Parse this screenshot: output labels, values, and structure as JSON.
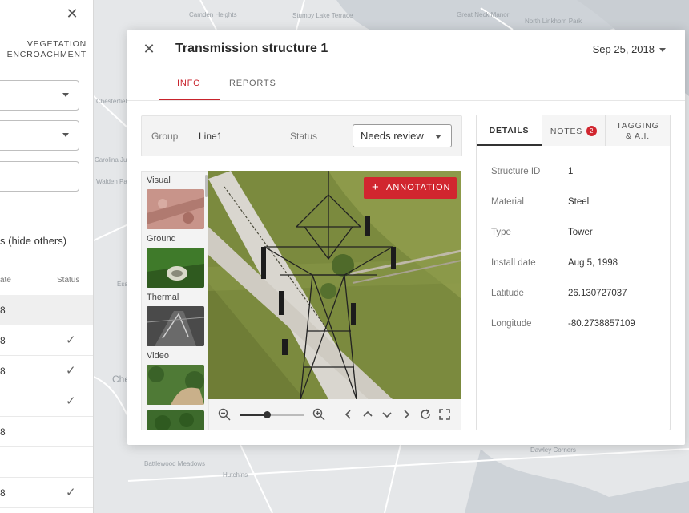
{
  "map": {
    "labels": [
      "Camden Heights",
      "Stumpy Lake Terrace",
      "Great Neck Manor",
      "North Linkhorn Park",
      "Chesterfield",
      "Carolina Junction",
      "Walden Park",
      "Essex",
      "Che",
      "Battlewood Meadows",
      "Hutchins",
      "Dawley Corners"
    ]
  },
  "left_panel": {
    "header_line1": "VEGETATION",
    "header_line2": "ENCROACHMENT",
    "toggle_label": "s (hide others)",
    "col_date": "ate",
    "col_status": "Status",
    "rows": [
      {
        "date": "8",
        "checked": false,
        "selected": true
      },
      {
        "date": "8",
        "checked": true
      },
      {
        "date": "8",
        "checked": true
      },
      {
        "date": "",
        "checked": true
      },
      {
        "date": "8",
        "checked": false
      },
      {
        "date": "",
        "checked": false
      },
      {
        "date": "8",
        "checked": true
      }
    ],
    "check_glyph": "✓"
  },
  "modal": {
    "title": "Transmission structure 1",
    "date": "Sep 25, 2018",
    "tabs": {
      "info": "INFO",
      "reports": "REPORTS"
    },
    "group_label": "Group",
    "group_value": "Line1",
    "status_label": "Status",
    "status_value": "Needs review",
    "thumbnails": {
      "visual": "Visual",
      "ground": "Ground",
      "thermal": "Thermal",
      "video": "Video"
    },
    "annotation_button": "ANNOTATION",
    "zoom_level": 0.42,
    "details_tabs": {
      "details": "DETAILS",
      "notes": "NOTES",
      "notes_count": "2",
      "tagging_line1": "TAGGING",
      "tagging_line2": "& A.I."
    },
    "details": [
      {
        "key": "Structure ID",
        "value": "1"
      },
      {
        "key": "Material",
        "value": "Steel"
      },
      {
        "key": "Type",
        "value": "Tower"
      },
      {
        "key": "Install date",
        "value": "Aug 5, 1998"
      },
      {
        "key": "Latitude",
        "value": "26.130727037"
      },
      {
        "key": "Longitude",
        "value": "-80.2738857109"
      }
    ]
  },
  "colors": {
    "accent": "#d1262f",
    "tab_active": "#c8232c"
  }
}
